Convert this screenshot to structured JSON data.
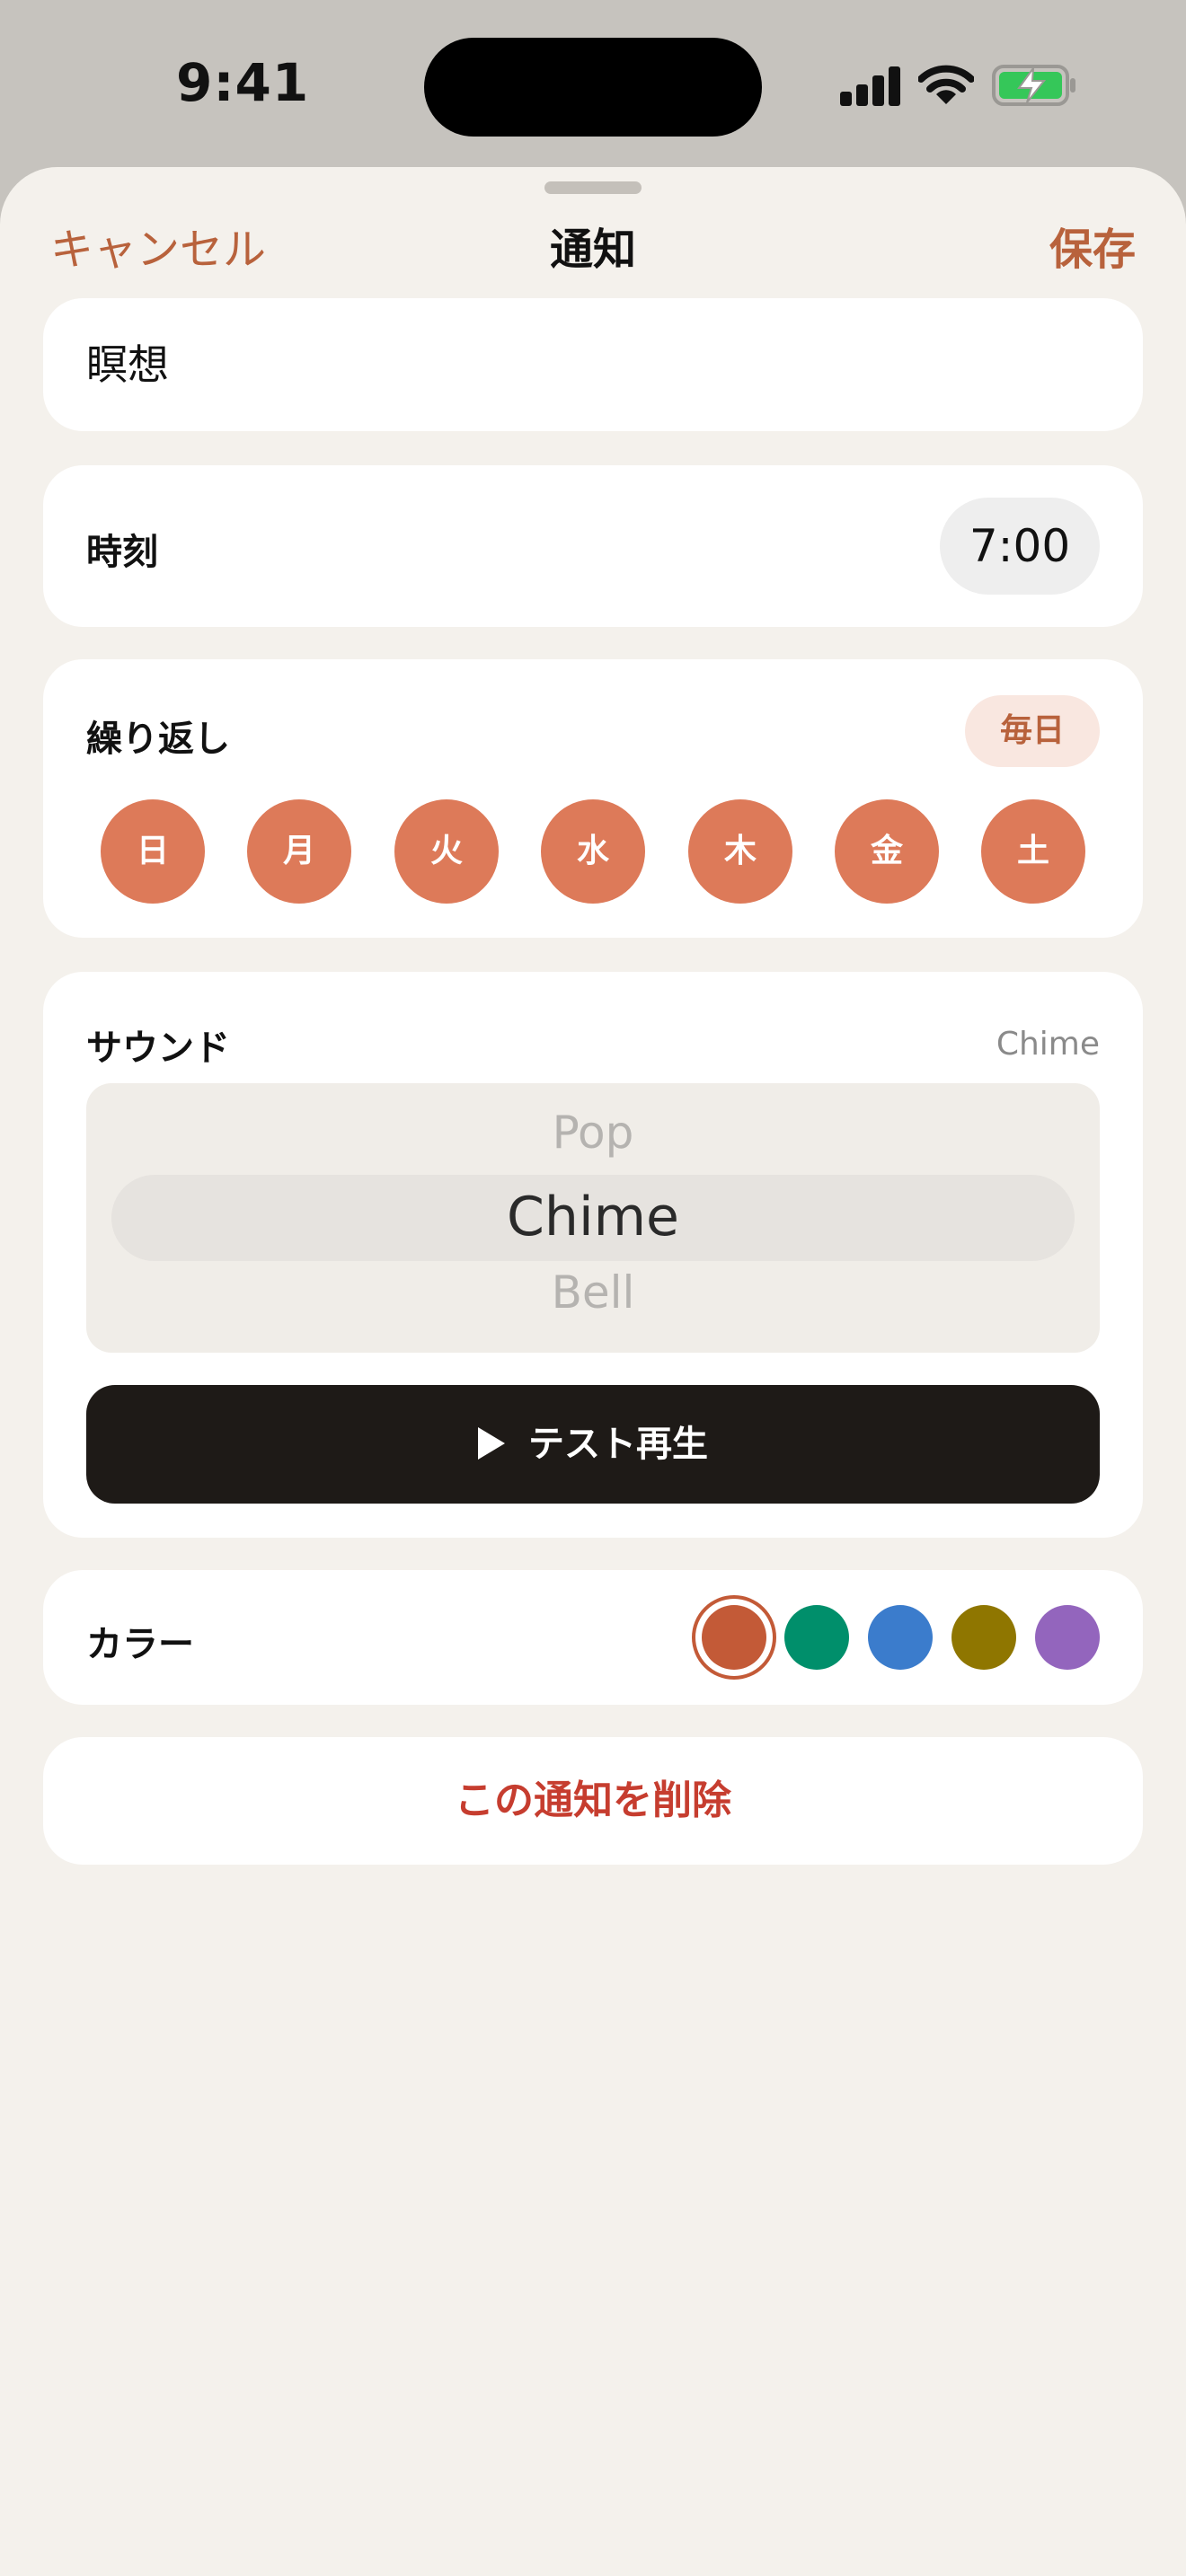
{
  "status_bar": {
    "time": "9:41"
  },
  "nav": {
    "cancel": "キャンセル",
    "title": "通知",
    "save": "保存"
  },
  "name": {
    "value": "瞑想"
  },
  "time_row": {
    "label": "時刻",
    "value": "7:00"
  },
  "repeat": {
    "label": "繰り返し",
    "badge": "毎日",
    "days": [
      "日",
      "月",
      "火",
      "水",
      "木",
      "金",
      "土"
    ]
  },
  "sound": {
    "label": "サウンド",
    "current": "Chime",
    "options": [
      "Pop",
      "Chime",
      "Bell"
    ],
    "play_label": "テスト再生"
  },
  "color": {
    "label": "カラー",
    "selected_index": 0,
    "swatches": [
      "#c35a37",
      "#008f6b",
      "#3b7ccc",
      "#8f7600",
      "#9365bd"
    ]
  },
  "delete_label": "この通知を削除"
}
